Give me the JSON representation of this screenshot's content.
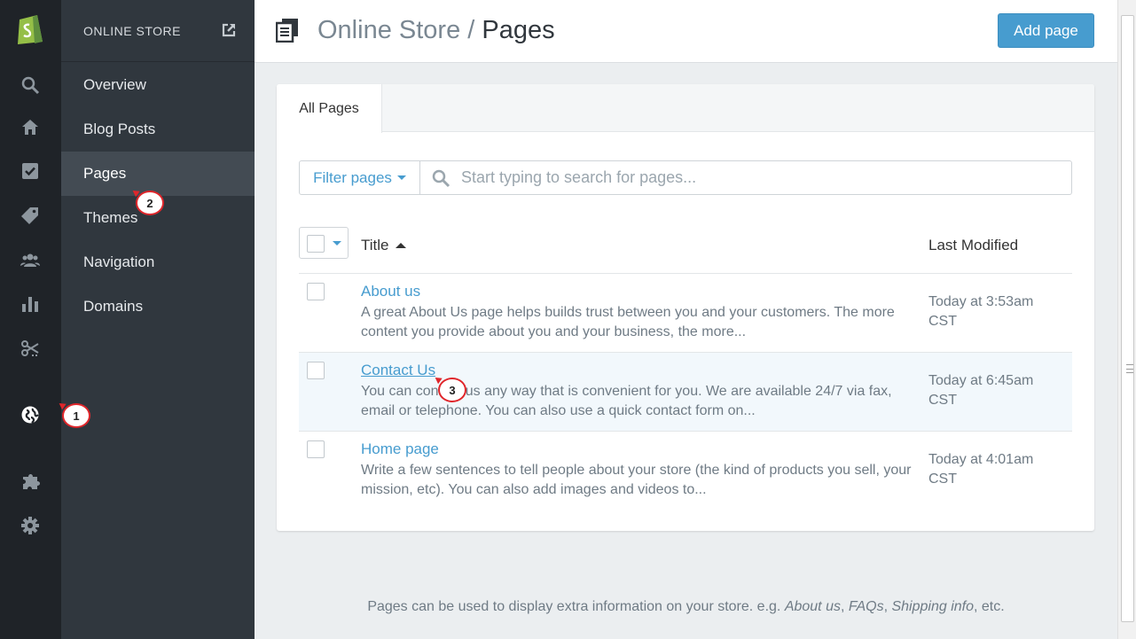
{
  "rail": {
    "icons": [
      "shopify-logo",
      "search-icon",
      "home-icon",
      "orders-icon",
      "products-icon",
      "customers-icon",
      "reports-icon",
      "discounts-icon",
      "online-store-icon",
      "apps-icon",
      "settings-icon"
    ]
  },
  "subnav": {
    "header": "ONLINE STORE",
    "items": [
      {
        "label": "Overview",
        "active": false
      },
      {
        "label": "Blog Posts",
        "active": false
      },
      {
        "label": "Pages",
        "active": true
      },
      {
        "label": "Themes",
        "active": false
      },
      {
        "label": "Navigation",
        "active": false
      },
      {
        "label": "Domains",
        "active": false
      }
    ]
  },
  "header": {
    "breadcrumb_parent": "Online Store",
    "separator": "/",
    "breadcrumb_current": "Pages",
    "add_button": "Add page"
  },
  "tabs": [
    {
      "label": "All Pages",
      "active": true
    }
  ],
  "filter": {
    "button_label": "Filter pages",
    "search_placeholder": "Start typing to search for pages..."
  },
  "table": {
    "columns": [
      "Title",
      "Last Modified"
    ],
    "rows": [
      {
        "title": "About us",
        "description": "A great About Us page helps builds trust between you and your customers. The more content you provide about you and your business, the more...",
        "modified": "Today at 3:53am CST"
      },
      {
        "title": "Contact Us",
        "description": "You can contact us any way that is convenient for you. We are available 24/7 via fax, email or telephone. You can also use a quick contact form on...",
        "modified": "Today at 6:45am CST"
      },
      {
        "title": "Home page",
        "description": "Write a few sentences to tell people about your store (the kind of products you sell, your mission, etc). You can also add images and videos to...",
        "modified": "Today at 4:01am CST"
      }
    ]
  },
  "footnote": {
    "prefix": "Pages can be used to display extra information on your store. e.g.",
    "link1": "About us",
    "sep1": ",",
    "link2": "FAQs",
    "sep2": ",",
    "link3": "Shipping info",
    "suffix": ", etc."
  },
  "markers": [
    "1",
    "2",
    "3"
  ],
  "colors": {
    "accent": "#479ccf",
    "rail_bg": "#1f2328",
    "subnav_bg": "#30373e",
    "marker_border": "#e0262b"
  }
}
